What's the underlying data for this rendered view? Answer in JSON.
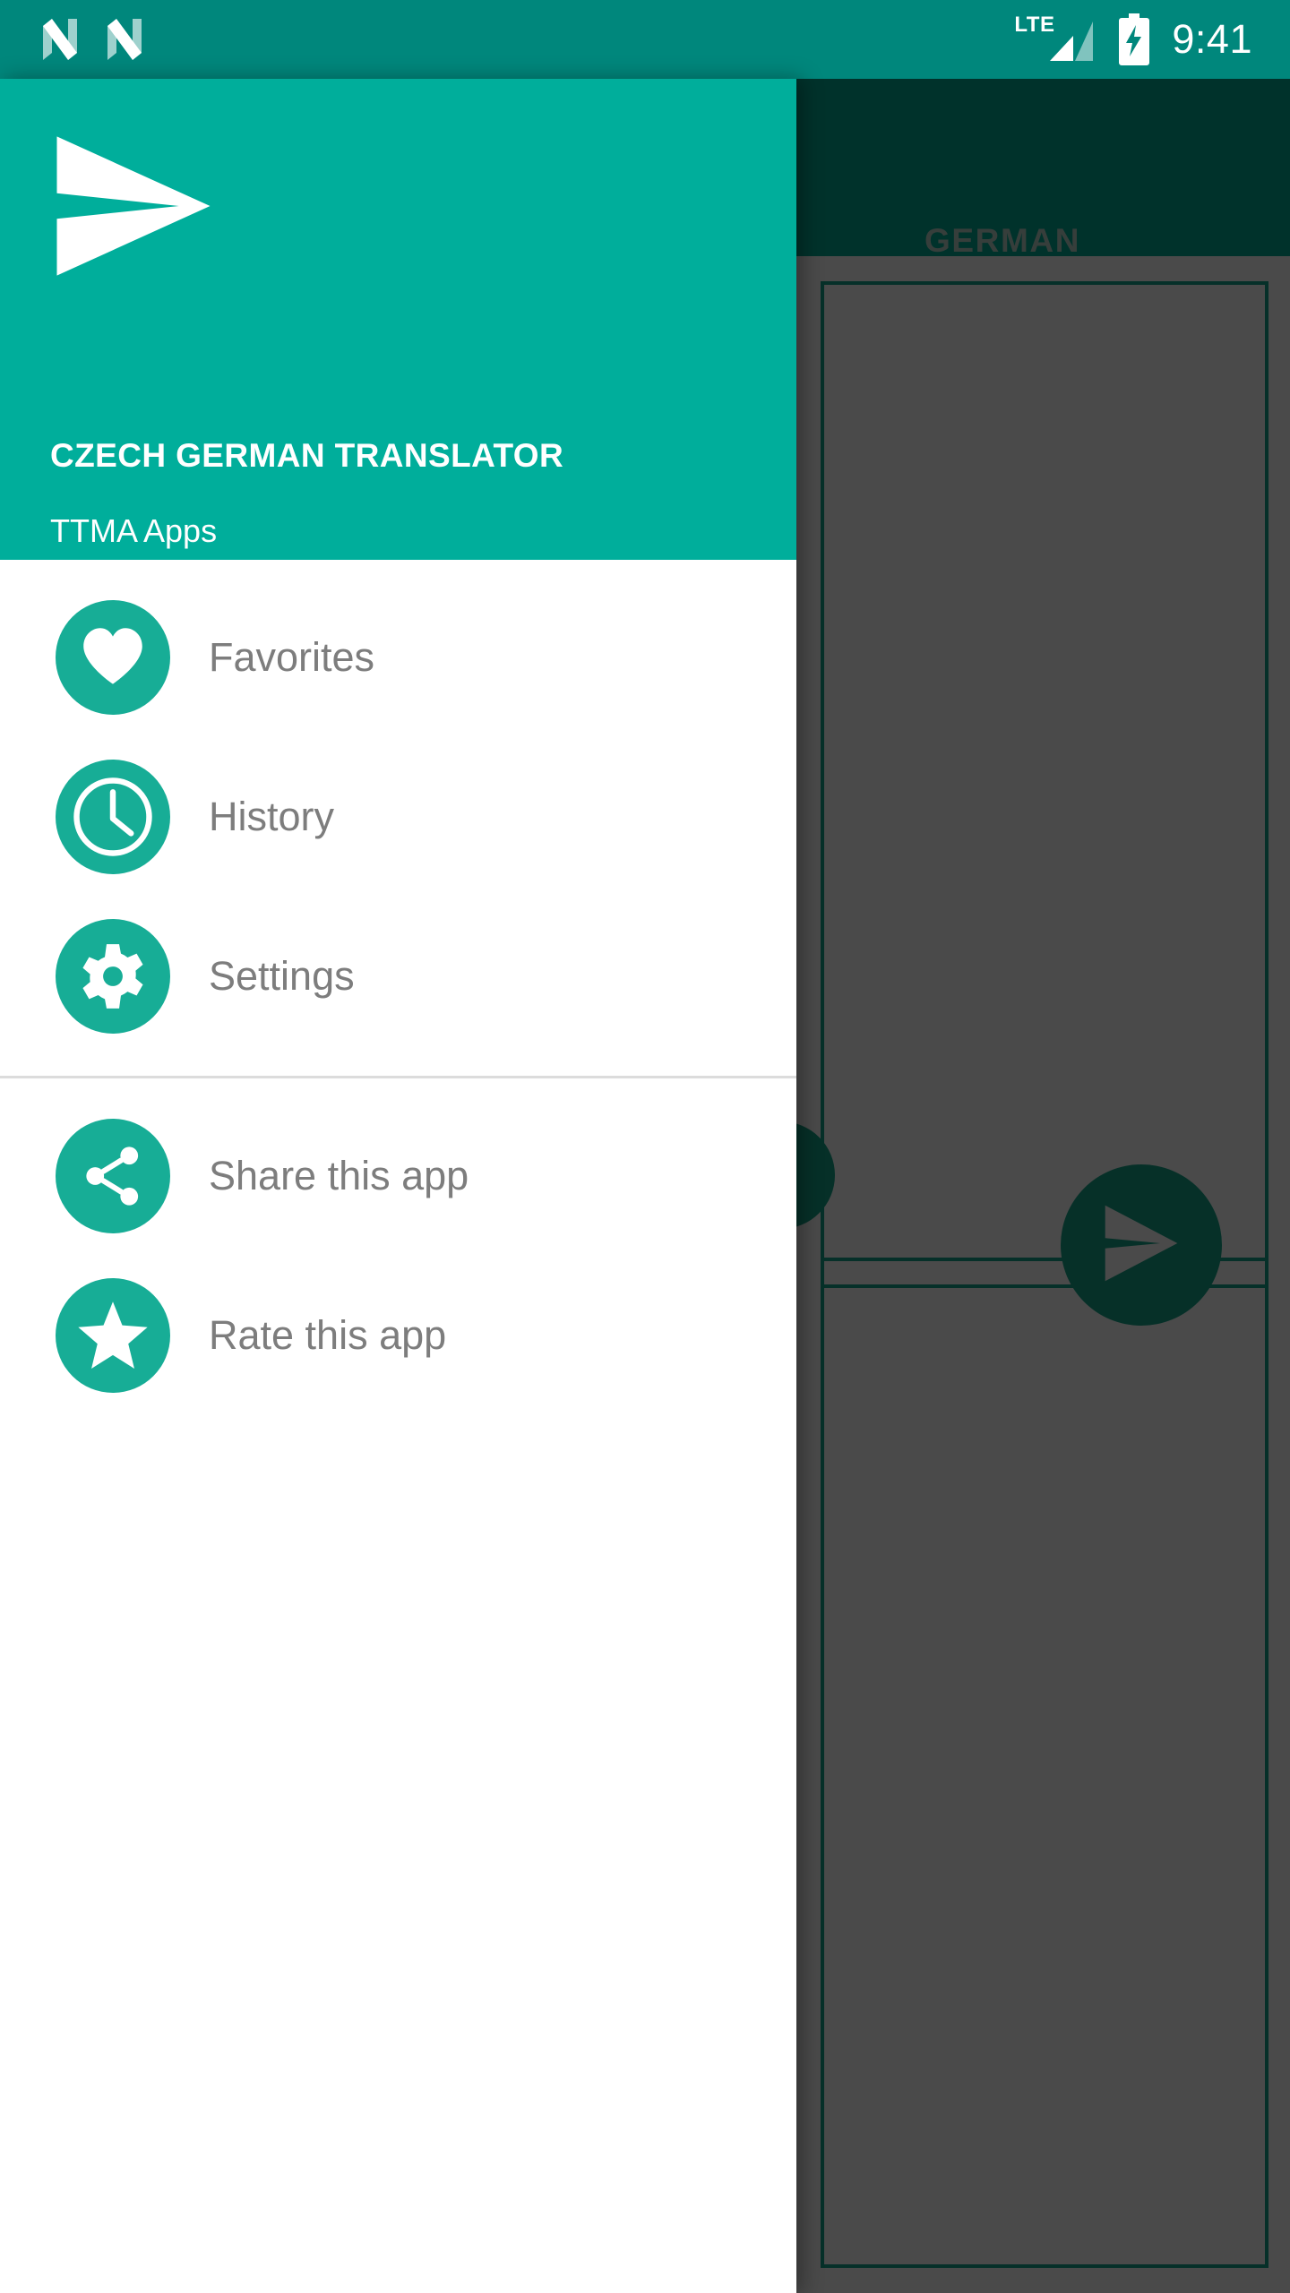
{
  "status_bar": {
    "notification_icons": [
      "android-n-logo-icon",
      "android-n-logo-icon"
    ],
    "network_label": "LTE",
    "signal_icon": "signal-bars-icon",
    "battery_icon": "battery-charging-icon",
    "time": "9:41",
    "background_color": "#00877C"
  },
  "drawer": {
    "header": {
      "logo_icon": "send-paper-plane-icon",
      "title": "CZECH GERMAN TRANSLATOR",
      "subtitle": "TTMA Apps",
      "background_color": "#00AE9B"
    },
    "primary_items": [
      {
        "label": "Favorites",
        "icon": "heart-icon"
      },
      {
        "label": "History",
        "icon": "clock-icon"
      },
      {
        "label": "Settings",
        "icon": "gear-icon"
      }
    ],
    "secondary_items": [
      {
        "label": "Share this app",
        "icon": "share-icon"
      },
      {
        "label": "Rate this app",
        "icon": "star-icon"
      }
    ],
    "icon_circle_color": "#17AD96",
    "label_color": "#7d7d7d"
  },
  "background_app": {
    "app_bar": {
      "tab_label": "GERMAN",
      "background_color": "#00564A"
    },
    "send_button_icon": "send-paper-plane-icon",
    "accent_color": "#0c5448",
    "scrim_color": "#666666"
  }
}
